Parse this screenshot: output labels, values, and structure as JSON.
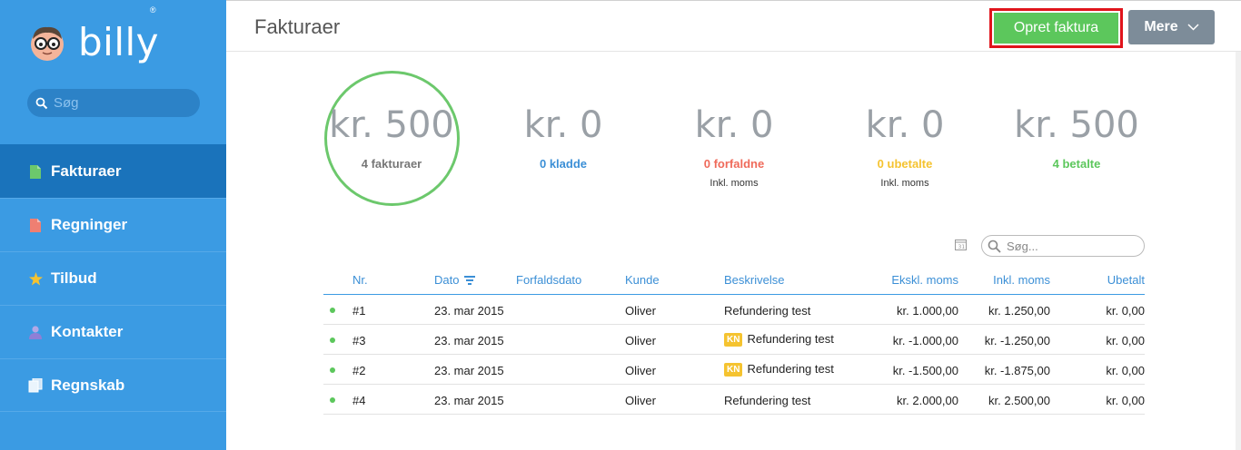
{
  "brand": {
    "name": "billy",
    "reg": "®"
  },
  "sidebar": {
    "search_placeholder": "Søg",
    "items": [
      {
        "label": "Fakturaer",
        "icon": "invoice-icon",
        "color": "#6cc86c",
        "active": true
      },
      {
        "label": "Regninger",
        "icon": "bill-icon",
        "color": "#ef7f72"
      },
      {
        "label": "Tilbud",
        "icon": "star-icon",
        "color": "#f5c330"
      },
      {
        "label": "Kontakter",
        "icon": "person-icon",
        "color": "#8f7fd6"
      },
      {
        "label": "Regnskab",
        "icon": "books-icon",
        "color": "#cfe4f7"
      }
    ]
  },
  "header": {
    "title": "Fakturaer",
    "create_label": "Opret faktura",
    "more_label": "Mere"
  },
  "stats": [
    {
      "amount": "kr. 500",
      "label": "4 fakturaer",
      "color": "#777777",
      "sub": ""
    },
    {
      "amount": "kr. 0",
      "label": "0 kladde",
      "color": "#3b8fd6",
      "sub": ""
    },
    {
      "amount": "kr. 0",
      "label": "0 forfaldne",
      "color": "#ef6a5a",
      "sub": "Inkl. moms"
    },
    {
      "amount": "kr. 0",
      "label": "0 ubetalte",
      "color": "#f5c330",
      "sub": "Inkl. moms"
    },
    {
      "amount": "kr. 500",
      "label": "4 betalte",
      "color": "#5cc75c",
      "sub": ""
    }
  ],
  "table": {
    "search_placeholder": "Søg...",
    "columns": {
      "nr": "Nr.",
      "date": "Dato",
      "due": "Forfaldsdato",
      "customer": "Kunde",
      "description": "Beskrivelse",
      "excl": "Ekskl. moms",
      "incl": "Inkl. moms",
      "unpaid": "Ubetalt"
    },
    "rows": [
      {
        "nr": "#1",
        "date": "23. mar 2015",
        "due": "",
        "customer": "Oliver",
        "badge": "",
        "description": "Refundering test",
        "excl": "kr. 1.000,00",
        "incl": "kr. 1.250,00",
        "unpaid": "kr. 0,00"
      },
      {
        "nr": "#3",
        "date": "23. mar 2015",
        "due": "",
        "customer": "Oliver",
        "badge": "KN",
        "description": "Refundering test",
        "excl": "kr. -1.000,00",
        "incl": "kr. -1.250,00",
        "unpaid": "kr. 0,00"
      },
      {
        "nr": "#2",
        "date": "23. mar 2015",
        "due": "",
        "customer": "Oliver",
        "badge": "KN",
        "description": "Refundering test",
        "excl": "kr. -1.500,00",
        "incl": "kr. -1.875,00",
        "unpaid": "kr. 0,00"
      },
      {
        "nr": "#4",
        "date": "23. mar 2015",
        "due": "",
        "customer": "Oliver",
        "badge": "",
        "description": "Refundering test",
        "excl": "kr. 2.000,00",
        "incl": "kr. 2.500,00",
        "unpaid": "kr. 0,00"
      }
    ]
  }
}
